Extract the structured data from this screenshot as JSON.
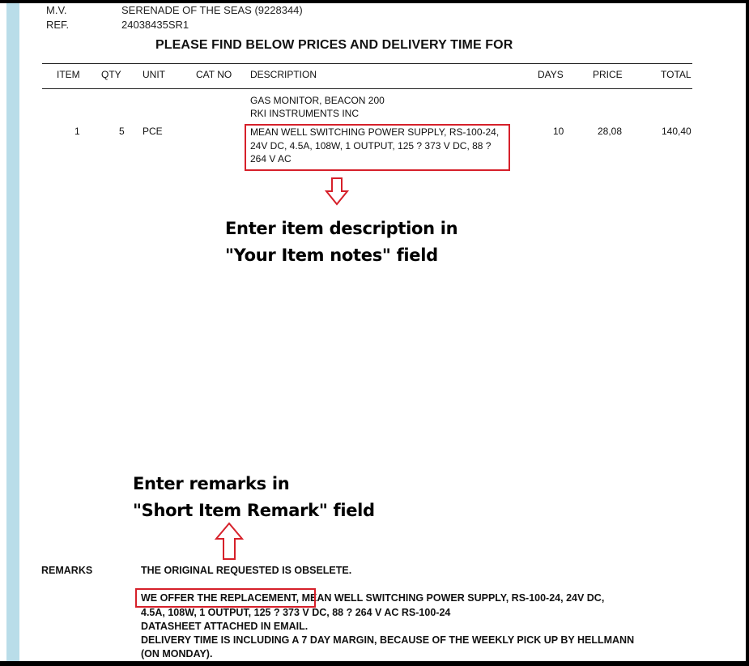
{
  "header": {
    "mv_label": "M.V.",
    "mv_value": "SERENADE OF THE SEAS (9228344)",
    "ref_label": "REF.",
    "ref_value": "24038435SR1"
  },
  "title": "PLEASE FIND BELOW PRICES AND DELIVERY TIME FOR",
  "columns": [
    "ITEM",
    "QTY",
    "UNIT",
    "CAT NO",
    "DESCRIPTION",
    "DAYS",
    "PRICE",
    "TOTAL"
  ],
  "item": {
    "desc_lines_top": [
      "GAS MONITOR, BEACON 200",
      "RKI INSTRUMENTS INC"
    ],
    "no": "1",
    "qty": "5",
    "unit": "PCE",
    "desc_lines_boxed": [
      "MEAN WELL SWITCHING POWER SUPPLY, RS-100-24,",
      "24V DC, 4.5A, 108W, 1 OUTPUT, 125 ? 373 V DC, 88 ?",
      "264 V AC"
    ],
    "days": "10",
    "price": "28,08",
    "total": "140,40"
  },
  "annotation_item": [
    "Enter item description in",
    "\"Your Item notes\" field"
  ],
  "annotation_remark": [
    "Enter remarks in",
    "\"Short Item Remark\" field"
  ],
  "remarks": {
    "label": "REMARKS",
    "line1": "THE ORIGINAL REQUESTED IS OBSELETE.",
    "highlight": "WE OFFER THE REPLACEMENT",
    "line2_rest": " MEAN WELL SWITCHING POWER SUPPLY, RS-100-24, 24V DC,",
    "line3": "4.5A, 108W, 1 OUTPUT, 125 ? 373 V DC, 88 ? 264 V AC RS-100-24",
    "line4": "DATASHEET ATTACHED IN EMAIL.",
    "line5": "DELIVERY TIME IS INCLUDING A 7 DAY MARGIN, BECAUSE OF THE WEEKLY PICK UP BY HELLMANN",
    "line6": "(ON MONDAY)."
  },
  "colors": {
    "highlight": "#d6202a",
    "stripe": "#b9dde9"
  }
}
